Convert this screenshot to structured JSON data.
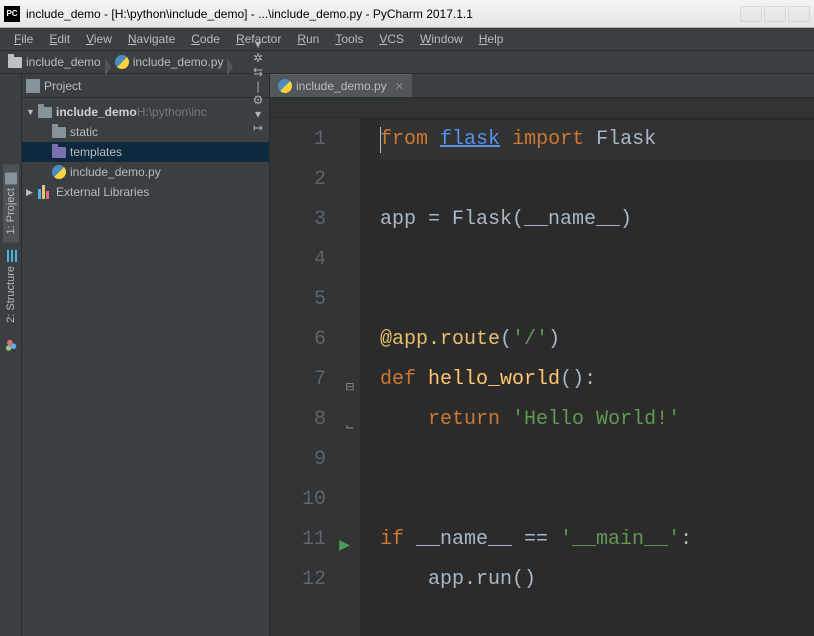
{
  "titlebar": {
    "appicon": "PC",
    "title": "include_demo - [H:\\python\\include_demo] - ...\\include_demo.py - PyCharm 2017.1.1"
  },
  "menu": [
    "File",
    "Edit",
    "View",
    "Navigate",
    "Code",
    "Refactor",
    "Run",
    "Tools",
    "VCS",
    "Window",
    "Help"
  ],
  "breadcrumb": [
    {
      "type": "folder",
      "label": "include_demo"
    },
    {
      "type": "pyfile",
      "label": "include_demo.py"
    }
  ],
  "left_tabs": [
    {
      "id": "project",
      "label": "1: Project",
      "icon": "proj"
    },
    {
      "id": "structure",
      "label": "2: Structure",
      "icon": "struct"
    }
  ],
  "project_header": {
    "title": "Project",
    "icons": [
      "▾",
      "✲",
      "⇆",
      "|",
      "⚙",
      "▾",
      "↦"
    ]
  },
  "tree": [
    {
      "lvl": 0,
      "exp": "down",
      "icon": "folder",
      "name": "include_demo",
      "suffix": " H:\\python\\inc",
      "bold": true
    },
    {
      "lvl": 1,
      "exp": "",
      "icon": "folder",
      "name": "static"
    },
    {
      "lvl": 1,
      "exp": "",
      "icon": "folder-purple",
      "name": "templates",
      "selected": true
    },
    {
      "lvl": 1,
      "exp": "",
      "icon": "pyfile",
      "name": "include_demo.py"
    },
    {
      "lvl": 0,
      "exp": "right",
      "icon": "lib",
      "name": "External Libraries"
    }
  ],
  "tab": {
    "label": "include_demo.py"
  },
  "code_lines": [
    {
      "n": 1,
      "caret": true,
      "tokens": [
        {
          "t": "cursor"
        },
        {
          "c": "kw",
          "t": "from"
        },
        {
          "t": " "
        },
        {
          "c": "lnk",
          "t": "flask"
        },
        {
          "t": " "
        },
        {
          "c": "kw",
          "t": "import"
        },
        {
          "t": " Flask"
        }
      ]
    },
    {
      "n": 2,
      "tokens": []
    },
    {
      "n": 3,
      "tokens": [
        {
          "t": "app = Flask(__name__)"
        }
      ]
    },
    {
      "n": 4,
      "tokens": []
    },
    {
      "n": 5,
      "tokens": []
    },
    {
      "n": 6,
      "tokens": [
        {
          "c": "dec",
          "t": "@app.route"
        },
        {
          "c": "punc",
          "t": "("
        },
        {
          "c": "str",
          "t": "'/'"
        },
        {
          "c": "punc",
          "t": ")"
        }
      ]
    },
    {
      "n": 7,
      "fold": true,
      "tokens": [
        {
          "c": "kw",
          "t": "def"
        },
        {
          "t": " "
        },
        {
          "c": "fn",
          "t": "hello_world"
        },
        {
          "c": "punc",
          "t": "():"
        }
      ]
    },
    {
      "n": 8,
      "foldend": true,
      "tokens": [
        {
          "t": "    "
        },
        {
          "c": "kw",
          "t": "return"
        },
        {
          "t": " "
        },
        {
          "c": "str",
          "t": "'Hello World!'"
        }
      ]
    },
    {
      "n": 9,
      "tokens": []
    },
    {
      "n": 10,
      "tokens": []
    },
    {
      "n": 11,
      "run": true,
      "tokens": [
        {
          "c": "kw",
          "t": "if"
        },
        {
          "t": " __name__ == "
        },
        {
          "c": "str",
          "t": "'__main__'"
        },
        {
          "c": "punc",
          "t": ":"
        }
      ]
    },
    {
      "n": 12,
      "tokens": [
        {
          "t": "    app.run()"
        }
      ]
    }
  ]
}
